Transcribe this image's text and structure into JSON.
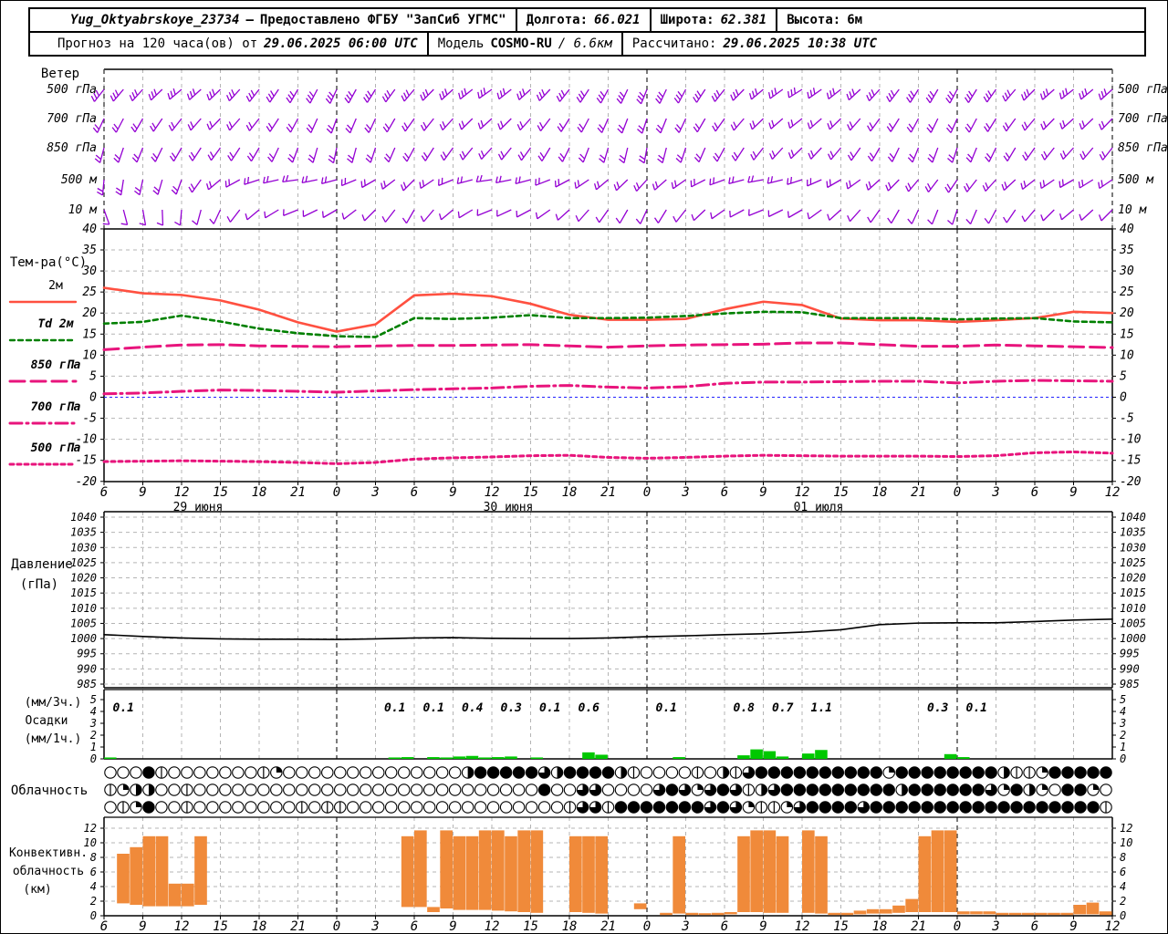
{
  "header": {
    "station": "Yug_Oktyabrskoye_23734",
    "dash": "—",
    "provider": "Предоставлено ФГБУ \"ЗапСиб УГМС\"",
    "lon_label": "Долгота:",
    "lon": "66.021",
    "lat_label": "Широта:",
    "lat": "62.381",
    "alt_label": "Высота:",
    "alt": "6м",
    "forecast_label": "Прогноз на 120 часа(ов) от",
    "forecast_start": "29.06.2025 06:00 UTC",
    "model_label": "Модель",
    "model_name": "COSMO-RU",
    "model_res": "/ 6.6км",
    "calc_label": "Рассчитано:",
    "calc_time": "29.06.2025 10:38 UTC"
  },
  "colors": {
    "barb": "#9400D3",
    "t2m": "#FF5040",
    "td": "#008000",
    "pink": "#E8147C",
    "zero_line": "#2222FF",
    "pressure_line": "#000000",
    "precip_bar": "#00C800",
    "conv_bar": "#F08A3A",
    "grid": "#B4B4B4",
    "day_line": "#444444",
    "axis": "#000000"
  },
  "chart_data": {
    "type": "meteogram",
    "time_ticks": [
      "6",
      "9",
      "12",
      "15",
      "18",
      "21",
      "0",
      "3",
      "6",
      "9",
      "12",
      "15",
      "18",
      "21",
      "0",
      "3",
      "6",
      "9",
      "12",
      "15",
      "18",
      "21",
      "0",
      "3",
      "6",
      "9",
      "12"
    ],
    "hours_step": 3,
    "dates": [
      {
        "label": "29 июня",
        "tick": 2
      },
      {
        "label": "30 июня",
        "tick": 10
      },
      {
        "label": "01 июля",
        "tick": 18
      }
    ],
    "day_boundary_ticks": [
      6,
      14,
      22
    ],
    "wind": {
      "title": "Ветер",
      "levels": [
        {
          "label": "500 гПа",
          "feathers": 3,
          "dirs": [
            218,
            222,
            230,
            226,
            218,
            210,
            205,
            212,
            220,
            228,
            235,
            228,
            218,
            208,
            202,
            208,
            218,
            230,
            238,
            232,
            222,
            212,
            208,
            215,
            225,
            232,
            228
          ]
        },
        {
          "label": "700 гПа",
          "feathers": 2,
          "dirs": [
            205,
            210,
            218,
            224,
            218,
            208,
            200,
            205,
            215,
            222,
            228,
            222,
            212,
            204,
            198,
            205,
            215,
            226,
            232,
            226,
            216,
            208,
            204,
            212,
            220,
            228,
            224
          ]
        },
        {
          "label": "850 гПа",
          "feathers": 2,
          "dirs": [
            195,
            202,
            210,
            216,
            210,
            200,
            192,
            198,
            208,
            216,
            222,
            216,
            206,
            196,
            190,
            198,
            208,
            218,
            226,
            220,
            210,
            202,
            198,
            206,
            215,
            222,
            218
          ]
        },
        {
          "label": "500 м",
          "feathers": 2,
          "dirs": [
            185,
            192,
            200,
            230,
            252,
            262,
            255,
            240,
            225,
            248,
            262,
            255,
            242,
            230,
            222,
            235,
            250,
            260,
            252,
            240,
            228,
            220,
            214,
            222,
            232,
            240,
            236
          ]
        },
        {
          "label": "10 м",
          "feathers": 1,
          "dirs": [
            160,
            170,
            185,
            205,
            230,
            248,
            240,
            225,
            210,
            230,
            248,
            242,
            228,
            215,
            205,
            218,
            235,
            248,
            240,
            228,
            215,
            205,
            198,
            208,
            220,
            230,
            225
          ]
        }
      ]
    },
    "temperature": {
      "title": "Тем-ра(°C)",
      "ylim": [
        -20,
        40
      ],
      "ystep": 5,
      "series": [
        {
          "name": "2м",
          "style": "solid",
          "color_key": "t2m",
          "values": [
            26.0,
            24.7,
            24.3,
            23.0,
            20.8,
            17.8,
            15.6,
            17.3,
            24.2,
            24.6,
            24.0,
            22.2,
            19.6,
            18.4,
            18.4,
            18.6,
            20.9,
            22.7,
            21.9,
            18.7,
            18.3,
            18.3,
            17.9,
            18.3,
            18.8,
            20.3,
            20.0
          ]
        },
        {
          "name": "Td 2м",
          "style": "dash",
          "color_key": "td",
          "values": [
            17.5,
            17.9,
            19.4,
            18.0,
            16.3,
            15.2,
            14.5,
            14.3,
            18.8,
            18.6,
            18.9,
            19.5,
            18.8,
            18.8,
            18.9,
            19.3,
            19.9,
            20.3,
            20.2,
            18.8,
            18.8,
            18.8,
            18.5,
            18.7,
            18.8,
            18.0,
            17.8
          ]
        },
        {
          "name": "850 гПа",
          "style": "longdash",
          "color_key": "pink",
          "values": [
            11.3,
            11.9,
            12.4,
            12.5,
            12.2,
            12.1,
            12.0,
            12.2,
            12.3,
            12.3,
            12.4,
            12.5,
            12.2,
            11.9,
            12.2,
            12.4,
            12.5,
            12.6,
            12.9,
            12.9,
            12.5,
            12.1,
            12.1,
            12.4,
            12.2,
            12.0,
            11.8
          ]
        },
        {
          "name": "700 гПа",
          "style": "dashdot",
          "color_key": "pink",
          "values": [
            0.8,
            1.0,
            1.4,
            1.7,
            1.6,
            1.4,
            1.2,
            1.5,
            1.8,
            2.0,
            2.2,
            2.6,
            2.8,
            2.4,
            2.2,
            2.5,
            3.3,
            3.6,
            3.6,
            3.7,
            3.8,
            3.8,
            3.4,
            3.8,
            4.0,
            3.9,
            3.8
          ]
        },
        {
          "name": "500 гПа",
          "style": "shortdash",
          "color_key": "pink",
          "values": [
            -15.3,
            -15.2,
            -15.1,
            -15.2,
            -15.3,
            -15.5,
            -15.8,
            -15.5,
            -14.7,
            -14.4,
            -14.2,
            -13.9,
            -13.8,
            -14.3,
            -14.5,
            -14.3,
            -14.0,
            -13.8,
            -13.9,
            -14.0,
            -14.0,
            -14.0,
            -14.1,
            -13.9,
            -13.2,
            -13.0,
            -13.3
          ]
        }
      ]
    },
    "pressure": {
      "title_lines": [
        "Давление",
        "(гПа)"
      ],
      "ylim": [
        985,
        1040
      ],
      "ystep": 5,
      "values": [
        1001.3,
        1000.7,
        1000.2,
        999.9,
        999.8,
        999.8,
        999.7,
        999.9,
        1000.2,
        1000.3,
        1000.1,
        1000.0,
        1000.0,
        1000.2,
        1000.6,
        1000.9,
        1001.3,
        1001.6,
        1002.1,
        1002.9,
        1004.6,
        1005.1,
        1005.2,
        1005.2,
        1005.6,
        1006.1,
        1006.4
      ]
    },
    "precipitation": {
      "labels": [
        "(мм/3ч.)",
        "Осадки",
        "(мм/1ч.)"
      ],
      "ylim": [
        0,
        5
      ],
      "amounts_3h": [
        {
          "slot": 0,
          "value": "0.1"
        },
        {
          "slot": 7,
          "value": "0.1"
        },
        {
          "slot": 8,
          "value": "0.1"
        },
        {
          "slot": 9,
          "value": "0.4"
        },
        {
          "slot": 10,
          "value": "0.3"
        },
        {
          "slot": 11,
          "value": "0.1"
        },
        {
          "slot": 12,
          "value": "0.6"
        },
        {
          "slot": 14,
          "value": "0.1"
        },
        {
          "slot": 16,
          "value": "0.8"
        },
        {
          "slot": 17,
          "value": "0.7"
        },
        {
          "slot": 18,
          "value": "1.1"
        },
        {
          "slot": 21,
          "value": "0.3"
        },
        {
          "slot": 22,
          "value": "0.1"
        }
      ],
      "hourly_bars": [
        [
          0,
          0.12
        ],
        [
          22,
          0.12
        ],
        [
          23,
          0.15
        ],
        [
          25,
          0.15
        ],
        [
          26,
          0.12
        ],
        [
          27,
          0.2
        ],
        [
          28,
          0.25
        ],
        [
          29,
          0.12
        ],
        [
          30,
          0.15
        ],
        [
          31,
          0.2
        ],
        [
          33,
          0.12
        ],
        [
          37,
          0.55
        ],
        [
          38,
          0.35
        ],
        [
          44,
          0.15
        ],
        [
          49,
          0.3
        ],
        [
          50,
          0.8
        ],
        [
          51,
          0.65
        ],
        [
          52,
          0.2
        ],
        [
          54,
          0.45
        ],
        [
          55,
          0.75
        ],
        [
          65,
          0.4
        ],
        [
          66,
          0.15
        ]
      ]
    },
    "cloudiness": {
      "title": "Облачность",
      "rows": [
        "0008100000001200000000000000488888648888410000104168888888888288888888411288888",
        "1244001000000000000000000000000000800660000686268614688888888848888886284208820",
        "0128001000000001011000000000000000001661888888868621126888868888888888888888881"
      ]
    },
    "convective": {
      "title_lines": [
        "Конвективн.",
        "облачность",
        "(км)"
      ],
      "ylim": [
        0,
        12
      ],
      "ystep": 2,
      "bars": [
        [
          1,
          1.7,
          8.5
        ],
        [
          2,
          1.5,
          9.4
        ],
        [
          3,
          1.3,
          10.9
        ],
        [
          4,
          1.3,
          10.9
        ],
        [
          5,
          1.3,
          4.4
        ],
        [
          6,
          1.3,
          4.4
        ],
        [
          7,
          1.5,
          10.9
        ],
        [
          23,
          1.2,
          10.9
        ],
        [
          24,
          1.2,
          11.7
        ],
        [
          25,
          0.5,
          1.2
        ],
        [
          26,
          1.0,
          11.7
        ],
        [
          27,
          0.8,
          10.9
        ],
        [
          28,
          0.8,
          10.9
        ],
        [
          29,
          0.8,
          11.7
        ],
        [
          30,
          0.7,
          11.7
        ],
        [
          31,
          0.6,
          10.9
        ],
        [
          32,
          0.5,
          11.7
        ],
        [
          33,
          0.4,
          11.7
        ],
        [
          36,
          0.5,
          10.9
        ],
        [
          37,
          0.4,
          10.9
        ],
        [
          38,
          0.3,
          10.9
        ],
        [
          41,
          0.9,
          1.7
        ],
        [
          43,
          0.1,
          0.4
        ],
        [
          44,
          0.3,
          10.9
        ],
        [
          45,
          0.1,
          0.4
        ],
        [
          46,
          0.1,
          0.35
        ],
        [
          47,
          0.1,
          0.4
        ],
        [
          48,
          0.2,
          0.5
        ],
        [
          49,
          0.5,
          10.9
        ],
        [
          50,
          0.5,
          11.7
        ],
        [
          51,
          0.4,
          11.7
        ],
        [
          52,
          0.4,
          10.9
        ],
        [
          54,
          0.4,
          11.7
        ],
        [
          55,
          0.3,
          10.9
        ],
        [
          56,
          0.1,
          0.4
        ],
        [
          57,
          0.1,
          0.4
        ],
        [
          58,
          0.2,
          0.7
        ],
        [
          59,
          0.3,
          0.9
        ],
        [
          60,
          0.3,
          0.9
        ],
        [
          61,
          0.4,
          1.4
        ],
        [
          62,
          0.5,
          2.3
        ],
        [
          63,
          0.5,
          10.9
        ],
        [
          64,
          0.5,
          11.7
        ],
        [
          65,
          0.5,
          11.7
        ],
        [
          66,
          0.2,
          0.6
        ],
        [
          67,
          0.2,
          0.6
        ],
        [
          68,
          0.2,
          0.6
        ],
        [
          69,
          0.1,
          0.4
        ],
        [
          70,
          0.1,
          0.4
        ],
        [
          71,
          0.1,
          0.4
        ],
        [
          72,
          0.1,
          0.4
        ],
        [
          73,
          0.1,
          0.4
        ],
        [
          74,
          0.1,
          0.4
        ],
        [
          75,
          0.2,
          1.5
        ],
        [
          76,
          0.2,
          1.8
        ],
        [
          77,
          0.1,
          0.6
        ]
      ]
    }
  }
}
